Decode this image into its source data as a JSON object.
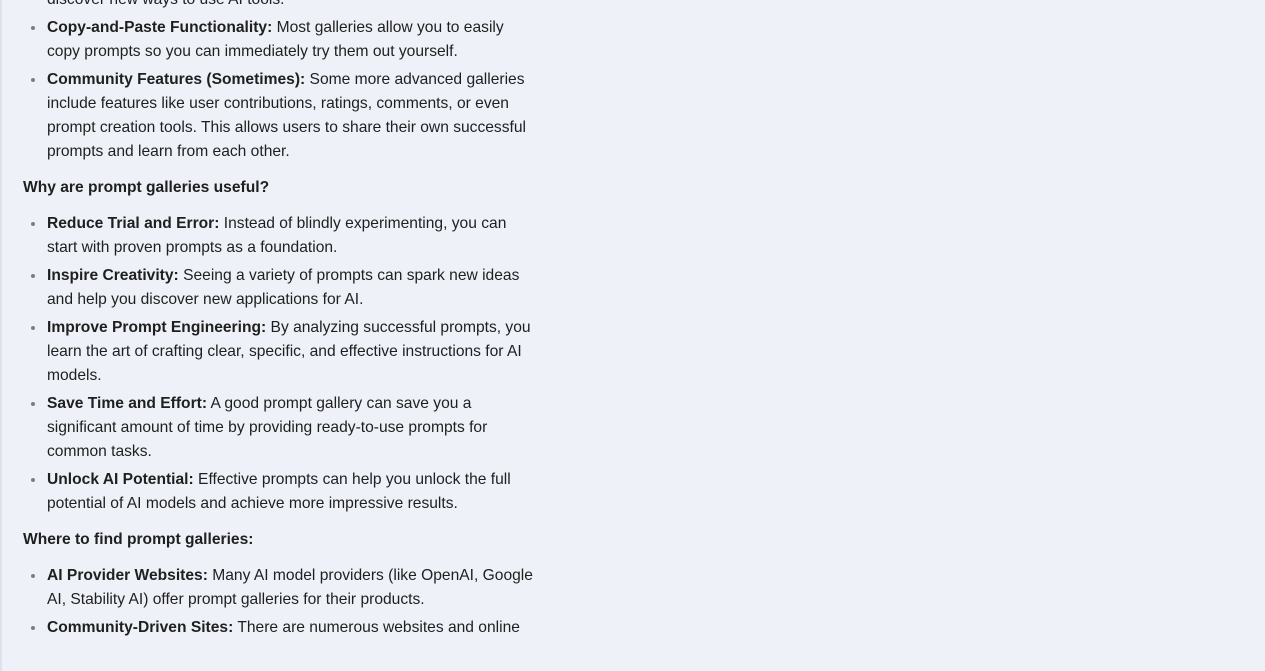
{
  "sections": [
    {
      "continuation_text": "discover new ways to use AI tools.",
      "items": [
        {
          "bold": "Copy-and-Paste Functionality:",
          "text": " Most galleries allow you to easily copy prompts so you can immediately try them out yourself."
        },
        {
          "bold": "Community Features (Sometimes):",
          "text": " Some more advanced galleries include features like user contributions, ratings, comments, or even prompt creation tools. This allows users to share their own successful prompts and learn from each other."
        }
      ]
    },
    {
      "heading": "Why are prompt galleries useful?",
      "items": [
        {
          "bold": "Reduce Trial and Error:",
          "text": " Instead of blindly experimenting, you can start with proven prompts as a foundation."
        },
        {
          "bold": "Inspire Creativity:",
          "text": " Seeing a variety of prompts can spark new ideas and help you discover new applications for AI."
        },
        {
          "bold": "Improve Prompt Engineering:",
          "text": " By analyzing successful prompts, you learn the art of crafting clear, specific, and effective instructions for AI models."
        },
        {
          "bold": "Save Time and Effort:",
          "text": " A good prompt gallery can save you a significant amount of time by providing ready-to-use prompts for common tasks."
        },
        {
          "bold": "Unlock AI Potential:",
          "text": " Effective prompts can help you unlock the full potential of AI models and achieve more impressive results."
        }
      ]
    },
    {
      "heading": "Where to find prompt galleries:",
      "items": [
        {
          "bold": "AI Provider Websites:",
          "text": " Many AI model providers (like OpenAI, Google AI, Stability AI) offer prompt galleries for their products."
        },
        {
          "bold": "Community-Driven Sites:",
          "text": " There are numerous websites and online"
        }
      ]
    }
  ]
}
